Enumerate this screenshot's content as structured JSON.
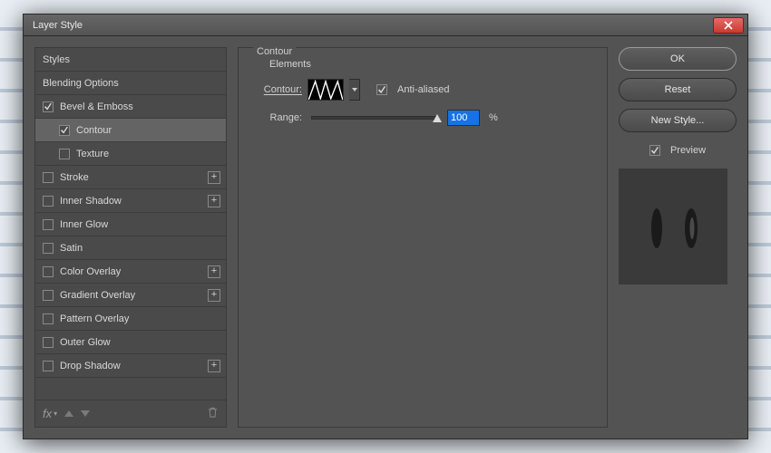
{
  "window": {
    "title": "Layer Style"
  },
  "styles_list": {
    "header": "Styles",
    "blending": "Blending Options",
    "items": [
      {
        "label": "Bevel & Emboss",
        "checked": true,
        "plus": false
      },
      {
        "label": "Contour",
        "checked": true,
        "sub": true,
        "selected": true
      },
      {
        "label": "Texture",
        "checked": false,
        "sub": true
      },
      {
        "label": "Stroke",
        "checked": false,
        "plus": true
      },
      {
        "label": "Inner Shadow",
        "checked": false,
        "plus": true
      },
      {
        "label": "Inner Glow",
        "checked": false
      },
      {
        "label": "Satin",
        "checked": false
      },
      {
        "label": "Color Overlay",
        "checked": false,
        "plus": true
      },
      {
        "label": "Gradient Overlay",
        "checked": false,
        "plus": true
      },
      {
        "label": "Pattern Overlay",
        "checked": false
      },
      {
        "label": "Outer Glow",
        "checked": false
      },
      {
        "label": "Drop Shadow",
        "checked": false,
        "plus": true
      }
    ],
    "footer_fx": "fx"
  },
  "panel": {
    "title": "Contour",
    "section": "Elements",
    "contour_label": "Contour:",
    "antialias_label": "Anti-aliased",
    "antialias_checked": true,
    "range_label": "Range:",
    "range_value": "100",
    "range_unit": "%",
    "range_pct": 100
  },
  "buttons": {
    "ok": "OK",
    "reset": "Reset",
    "new_style": "New Style..."
  },
  "preview": {
    "label": "Preview",
    "checked": true
  }
}
